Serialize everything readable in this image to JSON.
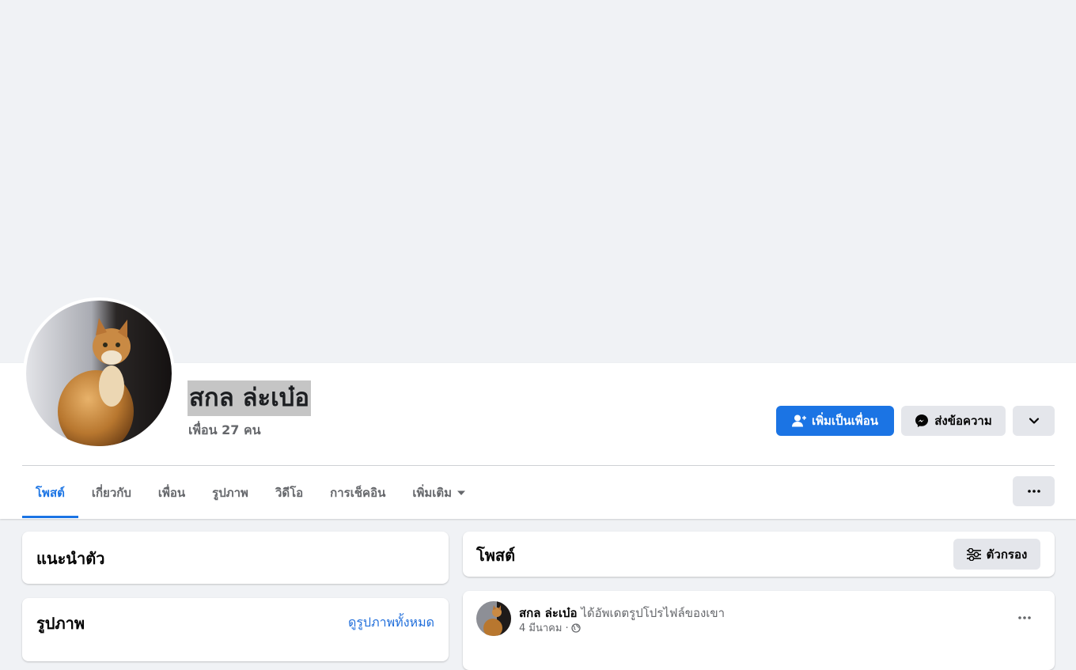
{
  "profile": {
    "name": "สกล ล่ะเบ๋อ",
    "friend_count": "เพื่อน 27 คน"
  },
  "actions": {
    "add_friend": "เพิ่มเป็นเพื่อน",
    "message": "ส่งข้อความ"
  },
  "tabs": [
    {
      "label": "โพสต์"
    },
    {
      "label": "เกี่ยวกับ"
    },
    {
      "label": "เพื่อน"
    },
    {
      "label": "รูปภาพ"
    },
    {
      "label": "วิดีโอ"
    },
    {
      "label": "การเช็คอิน"
    },
    {
      "label": "เพิ่มเติม"
    }
  ],
  "intro": {
    "title": "แนะนำตัว"
  },
  "photos": {
    "title": "รูปภาพ",
    "see_all": "ดูรูปภาพทั้งหมด"
  },
  "posts": {
    "title": "โพสต์",
    "filter_label": "ตัวกรอง"
  },
  "post": {
    "author": "สกล ล่ะเบ๋อ",
    "action": "ได้อัพเดตรูปโปรไฟล์ของเขา",
    "date": "4 มีนาคม · "
  },
  "colors": {
    "accent": "#1b74e4",
    "page_bg": "#f0f2f5",
    "secondary_button": "#e4e6eb"
  }
}
